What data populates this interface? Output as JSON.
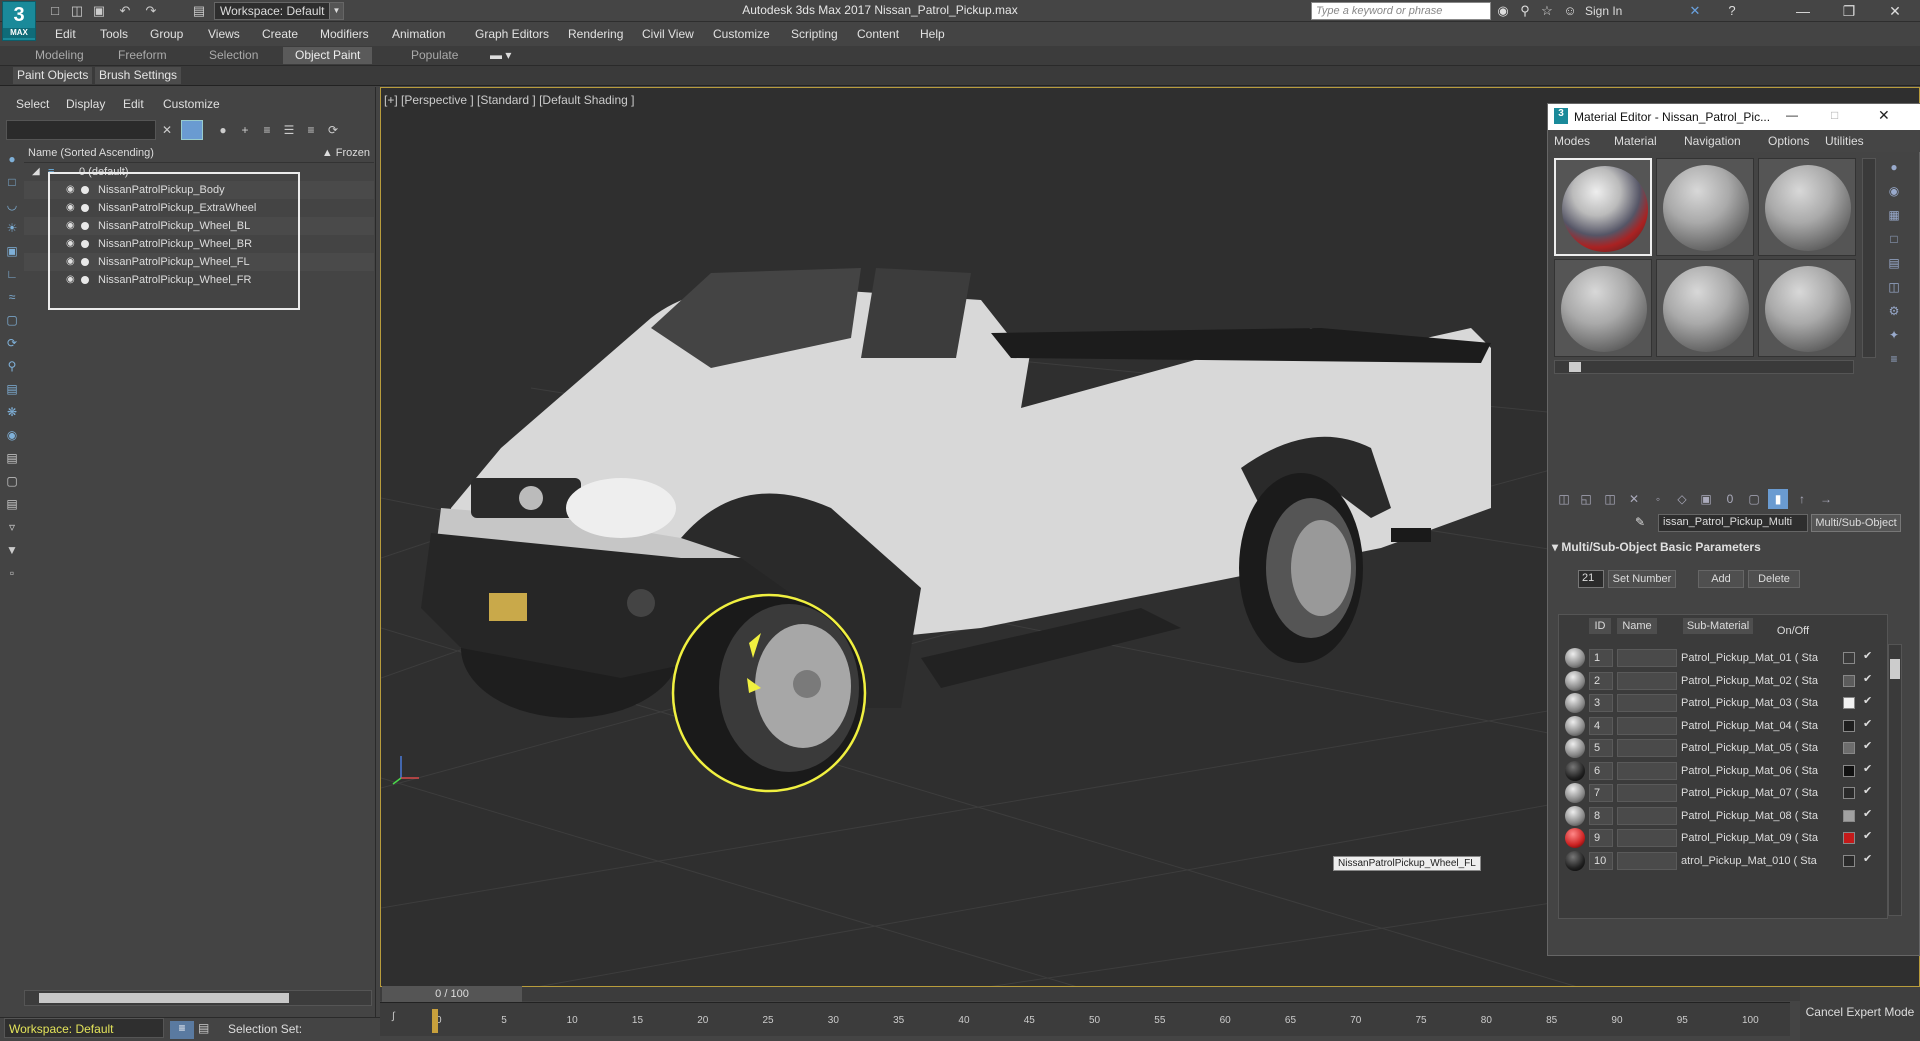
{
  "app": {
    "logo_text": "3",
    "logo_sub": "MAX",
    "title": "Autodesk 3ds Max 2017    Nissan_Patrol_Pickup.max",
    "workspace": "Workspace: Default",
    "search_placeholder": "Type a keyword or phrase",
    "sign_in": "Sign In"
  },
  "menu": [
    "Edit",
    "Tools",
    "Group",
    "Views",
    "Create",
    "Modifiers",
    "Animation",
    "Graph Editors",
    "Rendering",
    "Civil View",
    "Customize",
    "Scripting",
    "Content",
    "Help"
  ],
  "ribbon_tabs": [
    {
      "label": "Modeling",
      "active": false
    },
    {
      "label": "Freeform",
      "active": false
    },
    {
      "label": "Selection",
      "active": false
    },
    {
      "label": "Object Paint",
      "active": true
    },
    {
      "label": "Populate",
      "active": false
    }
  ],
  "ribbon_sub": [
    "Paint Objects",
    "Brush Settings"
  ],
  "scene_explorer": {
    "menu": [
      "Select",
      "Display",
      "Edit",
      "Customize"
    ],
    "column_name": "Name (Sorted Ascending)",
    "column_frozen": "▲ Frozen",
    "layer": "0 (default)",
    "objects": [
      "NissanPatrolPickup_Body",
      "NissanPatrolPickup_ExtraWheel",
      "NissanPatrolPickup_Wheel_BL",
      "NissanPatrolPickup_Wheel_BR",
      "NissanPatrolPickup_Wheel_FL",
      "NissanPatrolPickup_Wheel_FR"
    ]
  },
  "viewport": {
    "label": "[+] [Perspective ] [Standard ] [Default Shading ]",
    "tooltip": "NissanPatrolPickup_Wheel_FL"
  },
  "material_editor": {
    "title": "Material Editor - Nissan_Patrol_Pic...",
    "menu": [
      "Modes",
      "Material",
      "Navigation",
      "Options",
      "Utilities"
    ],
    "material_name": "issan_Patrol_Pickup_Multi",
    "material_type": "Multi/Sub-Object",
    "rollout": "Multi/Sub-Object Basic Parameters",
    "number": "21",
    "set_number": "Set Number",
    "add": "Add",
    "delete": "Delete",
    "col_id": "ID",
    "col_name": "Name",
    "col_sub": "Sub-Material",
    "col_onoff": "On/Off",
    "rows": [
      {
        "id": "1",
        "sub": "Patrol_Pickup_Mat_01  ( Sta",
        "swatch": "#3a3a3a"
      },
      {
        "id": "2",
        "sub": "Patrol_Pickup_Mat_02  ( Sta",
        "swatch": "#5c5c5c"
      },
      {
        "id": "3",
        "sub": "Patrol_Pickup_Mat_03  ( Sta",
        "swatch": "#f2f2f2"
      },
      {
        "id": "4",
        "sub": "Patrol_Pickup_Mat_04  ( Sta",
        "swatch": "#1e1e1e"
      },
      {
        "id": "5",
        "sub": "Patrol_Pickup_Mat_05  ( Sta",
        "swatch": "#6d6d6d"
      },
      {
        "id": "6",
        "sub": "Patrol_Pickup_Mat_06  ( Sta",
        "swatch": "#111111"
      },
      {
        "id": "7",
        "sub": "Patrol_Pickup_Mat_07  ( Sta",
        "swatch": "#2a2a2a"
      },
      {
        "id": "8",
        "sub": "Patrol_Pickup_Mat_08  ( Sta",
        "swatch": "#a0a0a0"
      },
      {
        "id": "9",
        "sub": "Patrol_Pickup_Mat_09  ( Sta",
        "swatch": "#c41a1a"
      },
      {
        "id": "10",
        "sub": "atrol_Pickup_Mat_010  ( Sta",
        "swatch": "#2a2a2a"
      }
    ]
  },
  "timeline": {
    "frame": "0 / 100",
    "ticks": [
      "0",
      "5",
      "10",
      "15",
      "20",
      "25",
      "30",
      "35",
      "40",
      "45",
      "50",
      "55",
      "60",
      "65",
      "70",
      "75",
      "80",
      "85",
      "90",
      "95",
      "100"
    ],
    "cancel_expert": "Cancel Expert Mode"
  },
  "status": {
    "workspace": "Workspace: Default",
    "selection_set": "Selection Set:"
  }
}
